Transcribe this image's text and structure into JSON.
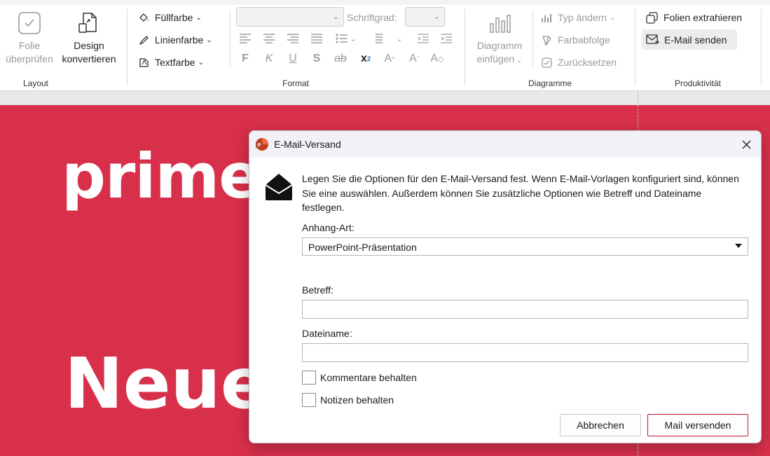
{
  "ribbon": {
    "groups": {
      "layout": "Layout",
      "format": "Format",
      "diagramme": "Diagramme",
      "produktivitaet": "Produktivität"
    },
    "layout": {
      "folie_line1": "Folie",
      "folie_line2": "überprüfen",
      "design_line1": "Design",
      "design_line2": "konvertieren"
    },
    "format": {
      "fuellfarbe": "Füllfarbe",
      "linienfarbe": "Linienfarbe",
      "textfarbe": "Textfarbe",
      "schriftgrad_label": "Schriftgrad:",
      "font_value": "",
      "size_value": ""
    },
    "diagramme": {
      "einfuegen_line1": "Diagramm",
      "einfuegen_line2": "einfügen",
      "typ_aendern": "Typ ändern",
      "farbabfolge": "Farbabfolge",
      "zuruecksetzen": "Zurücksetzen"
    },
    "produktivitaet": {
      "folien_extrahieren": "Folien extrahieren",
      "email_senden": "E-Mail senden"
    }
  },
  "slide": {
    "logo_text": "primed",
    "headline": "Neues",
    "background_color": "#d8304b"
  },
  "dialog": {
    "title": "E-Mail-Versand",
    "description": "Legen Sie die Optionen für den E-Mail-Versand fest. Wenn E-Mail-Vorlagen konfiguriert sind, können Sie eine auswählen. Außerdem können Sie zusätzliche Optionen wie Betreff und Dateiname festlegen.",
    "anhang_label": "Anhang-Art:",
    "anhang_value": "PowerPoint-Präsentation",
    "betreff_label": "Betreff:",
    "betreff_value": "",
    "dateiname_label": "Dateiname:",
    "dateiname_value": "",
    "kommentare_label": "Kommentare behalten",
    "kommentare_checked": false,
    "notizen_label": "Notizen behalten",
    "notizen_checked": false,
    "cancel_label": "Abbrechen",
    "submit_label": "Mail versenden",
    "accent_color": "#c8102e"
  }
}
